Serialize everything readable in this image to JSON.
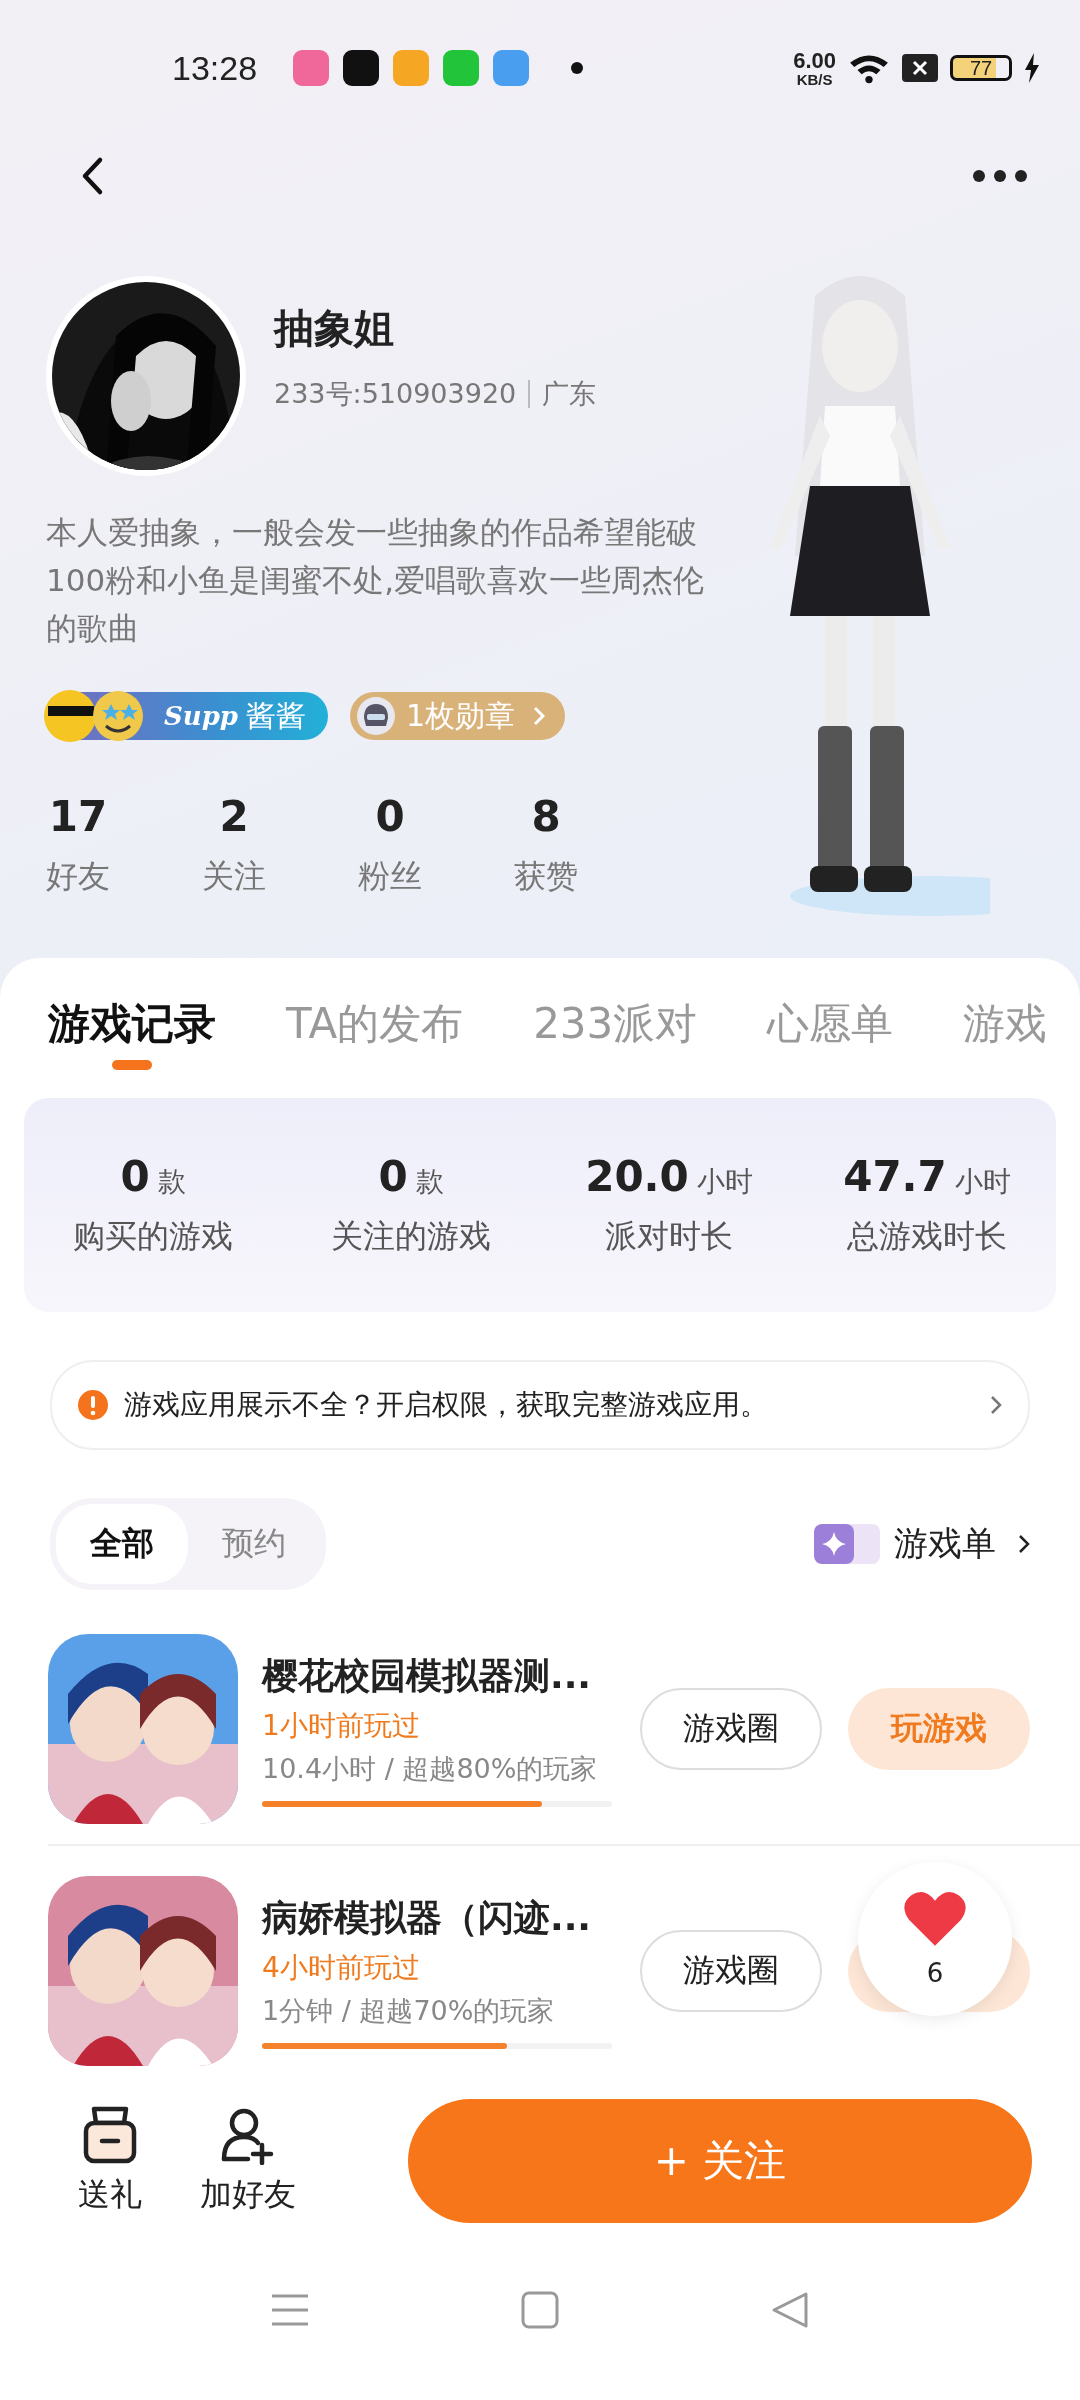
{
  "status_bar": {
    "time": "13:28",
    "speed_value": "6.00",
    "speed_unit": "KB/S",
    "battery": "77",
    "notification_apps": [
      {
        "color": "#f0689a"
      },
      {
        "color": "#111111"
      },
      {
        "color": "#f5a623"
      },
      {
        "color": "#22c53a"
      },
      {
        "color": "#4a9ef0"
      }
    ]
  },
  "profile": {
    "name": "抽象姐",
    "account_id": "233号:510903920",
    "region": "广东",
    "bio": "本人爱抽象，一般会发一些抽象的作品希望能破100粉和小鱼是闺蜜不处,爱唱歌喜欢一些周杰伦的歌曲",
    "tag_label": "Supp",
    "tag_name": "酱酱",
    "medal": "1枚勋章"
  },
  "stats": [
    {
      "value": "17",
      "label": "好友"
    },
    {
      "value": "2",
      "label": "关注"
    },
    {
      "value": "0",
      "label": "粉丝"
    },
    {
      "value": "8",
      "label": "获赞"
    }
  ],
  "tabs": [
    {
      "label": "游戏记录",
      "selected": true
    },
    {
      "label": "TA的发布",
      "selected": false
    },
    {
      "label": "233派对",
      "selected": false
    },
    {
      "label": "心愿单",
      "selected": false
    },
    {
      "label": "游戏",
      "selected": false
    }
  ],
  "summary": [
    {
      "value": "0",
      "unit": "款",
      "label": "购买的游戏"
    },
    {
      "value": "0",
      "unit": "款",
      "label": "关注的游戏"
    },
    {
      "value": "20.0",
      "unit": "小时",
      "label": "派对时长"
    },
    {
      "value": "47.7",
      "unit": "小时",
      "label": "总游戏时长"
    }
  ],
  "notice": "游戏应用展示不全？开启权限，获取完整游戏应用。",
  "filters": [
    {
      "label": "全部",
      "selected": true
    },
    {
      "label": "预约",
      "selected": false
    }
  ],
  "game_list_link": "游戏单",
  "games": [
    {
      "title": "樱花校园模拟器测...",
      "last_played": "1小时前玩过",
      "playtime": "10.4小时 / 超越80%的玩家",
      "level": 0.8,
      "circle_button": "游戏圈",
      "play_button": "玩游戏"
    },
    {
      "title": "病娇模拟器（闪迹...",
      "last_played": "4小时前玩过",
      "playtime": "1分钟 / 超越70%的玩家",
      "level": 0.7,
      "circle_button": "游戏圈"
    }
  ],
  "likes": {
    "count": "6"
  },
  "bottom_bar": {
    "gift": "送礼",
    "add_friend": "加好友",
    "follow": "+ 关注"
  }
}
